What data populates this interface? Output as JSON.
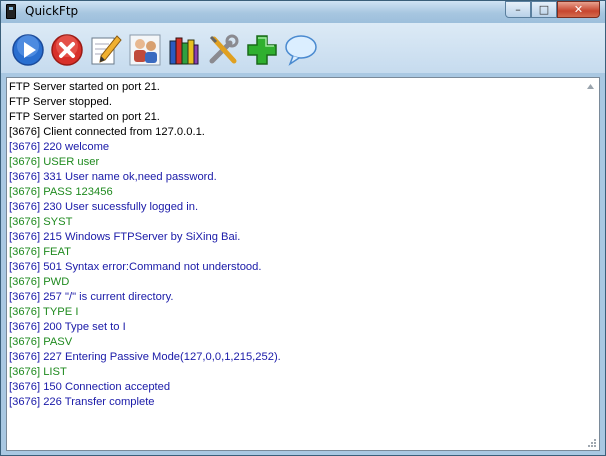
{
  "window": {
    "title": "QuickFtp"
  },
  "toolbar": {
    "buttons": [
      {
        "icon": "play-icon",
        "kind": "start"
      },
      {
        "icon": "stop-icon",
        "kind": "stop"
      },
      {
        "icon": "pencil-icon",
        "kind": "edit"
      },
      {
        "icon": "users-icon",
        "kind": "users"
      },
      {
        "icon": "books-icon",
        "kind": "library"
      },
      {
        "icon": "tools-icon",
        "kind": "settings"
      },
      {
        "icon": "plus-icon",
        "kind": "add"
      },
      {
        "icon": "speech-bubble-icon",
        "kind": "about"
      }
    ]
  },
  "colors": {
    "server": "#000000",
    "response": "#1a1aa8",
    "command": "#1f8a1f"
  },
  "log": [
    {
      "text": "FTP Server started on port 21.",
      "kind": "server"
    },
    {
      "text": "FTP Server stopped.",
      "kind": "server"
    },
    {
      "text": "FTP Server started on port 21.",
      "kind": "server"
    },
    {
      "text": "[3676] Client connected from 127.0.0.1.",
      "kind": "server"
    },
    {
      "text": "[3676] 220 welcome",
      "kind": "response"
    },
    {
      "text": "[3676] USER user",
      "kind": "command"
    },
    {
      "text": "[3676] 331 User name ok,need password.",
      "kind": "response"
    },
    {
      "text": "[3676] PASS 123456",
      "kind": "command"
    },
    {
      "text": "[3676] 230 User sucessfully logged in.",
      "kind": "response"
    },
    {
      "text": "[3676] SYST",
      "kind": "command"
    },
    {
      "text": "[3676] 215 Windows FTPServer by SiXing Bai.",
      "kind": "response"
    },
    {
      "text": "[3676] FEAT",
      "kind": "command"
    },
    {
      "text": "[3676] 501 Syntax error:Command not understood.",
      "kind": "response"
    },
    {
      "text": "[3676] PWD",
      "kind": "command"
    },
    {
      "text": "[3676] 257 \"/\" is current directory.",
      "kind": "response"
    },
    {
      "text": "[3676] TYPE I",
      "kind": "command"
    },
    {
      "text": "[3676] 200 Type set to I",
      "kind": "response"
    },
    {
      "text": "[3676] PASV",
      "kind": "command"
    },
    {
      "text": "[3676] 227 Entering Passive Mode(127,0,0,1,215,252).",
      "kind": "response"
    },
    {
      "text": "[3676] LIST",
      "kind": "command"
    },
    {
      "text": "[3676] 150 Connection accepted",
      "kind": "response"
    },
    {
      "text": "[3676] 226 Transfer complete",
      "kind": "response"
    }
  ]
}
